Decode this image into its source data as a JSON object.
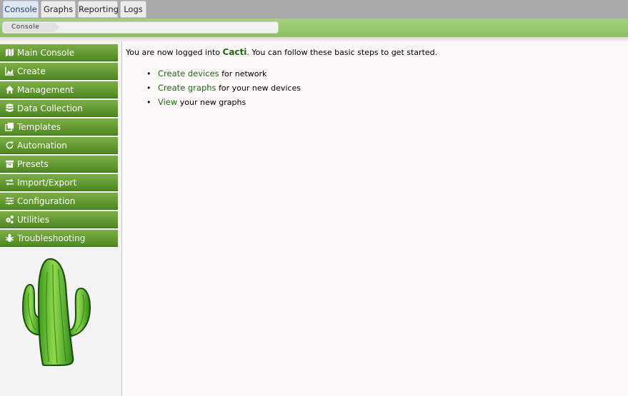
{
  "tabs": [
    {
      "label": "Console",
      "active": true
    },
    {
      "label": "Graphs",
      "active": false
    },
    {
      "label": "Reporting",
      "active": false
    },
    {
      "label": "Logs",
      "active": false
    }
  ],
  "breadcrumb": {
    "current": "Console"
  },
  "sidebar": {
    "items": [
      {
        "label": "Main Console",
        "icon": "map-icon"
      },
      {
        "label": "Create",
        "icon": "area-chart-icon"
      },
      {
        "label": "Management",
        "icon": "home-icon"
      },
      {
        "label": "Data Collection",
        "icon": "database-icon"
      },
      {
        "label": "Templates",
        "icon": "copy-icon"
      },
      {
        "label": "Automation",
        "icon": "refresh-icon"
      },
      {
        "label": "Presets",
        "icon": "archive-icon"
      },
      {
        "label": "Import/Export",
        "icon": "exchange-icon"
      },
      {
        "label": "Configuration",
        "icon": "sliders-icon"
      },
      {
        "label": "Utilities",
        "icon": "cogs-icon"
      },
      {
        "label": "Troubleshooting",
        "icon": "bug-icon"
      }
    ]
  },
  "main": {
    "intro_before": "You are now logged into ",
    "brand": "Cacti",
    "intro_after": ". You can follow these basic steps to get started.",
    "steps": [
      {
        "link": "Create devices",
        "text": " for network"
      },
      {
        "link": "Create graphs",
        "text": " for your new devices"
      },
      {
        "link": "View",
        "text": " your new graphs"
      }
    ]
  },
  "colors": {
    "accent_green": "#4e8722",
    "link_green": "#1f6b12",
    "tabbar_gray": "#a9a9a9"
  }
}
